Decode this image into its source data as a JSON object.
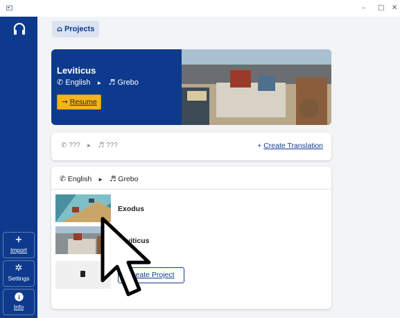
{
  "window": {
    "minimize": "–",
    "maximize": "□",
    "close": "✕"
  },
  "sidebar": {
    "logo_icon": "headphones-icon",
    "import": {
      "icon": "+",
      "label": "Import"
    },
    "settings": {
      "icon": "✲",
      "label": "Settings"
    },
    "info": {
      "icon": "i",
      "label": "Info"
    }
  },
  "breadcrumb": {
    "icon": "home-icon",
    "label": "Projects"
  },
  "hero": {
    "title": "Leviticus",
    "source_language": "English",
    "target_language": "Grebo",
    "resume_label": "Resume"
  },
  "new_translation": {
    "source_language": "???",
    "target_language": "???",
    "create_label": "Create Translation"
  },
  "project": {
    "source_language": "English",
    "target_language": "Grebo",
    "books": [
      {
        "name": "Exodus"
      },
      {
        "name": "Leviticus"
      }
    ],
    "create_label": "Create Project"
  },
  "colors": {
    "sidebar": "#0d3a8c",
    "accent": "#0d3a8c",
    "resume": "#f5b41c",
    "background": "#f3f4f6"
  }
}
